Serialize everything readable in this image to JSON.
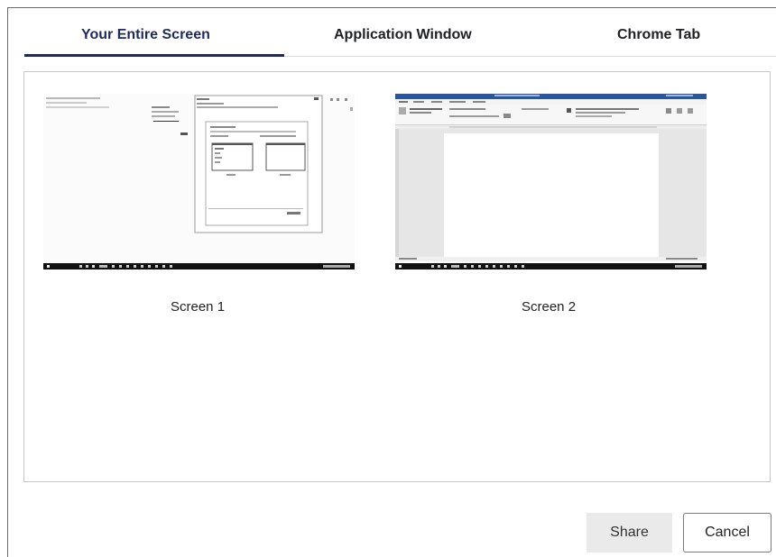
{
  "tabs": [
    {
      "label": "Your Entire Screen",
      "active": true
    },
    {
      "label": "Application Window",
      "active": false
    },
    {
      "label": "Chrome Tab",
      "active": false
    }
  ],
  "screens": [
    {
      "label": "Screen 1"
    },
    {
      "label": "Screen 2"
    }
  ],
  "buttons": {
    "share_label": "Share",
    "cancel_label": "Cancel"
  },
  "colors": {
    "active_tab": "#1f2a5a",
    "taskbar": "#111111",
    "word_ribbon": "#2b579a"
  }
}
